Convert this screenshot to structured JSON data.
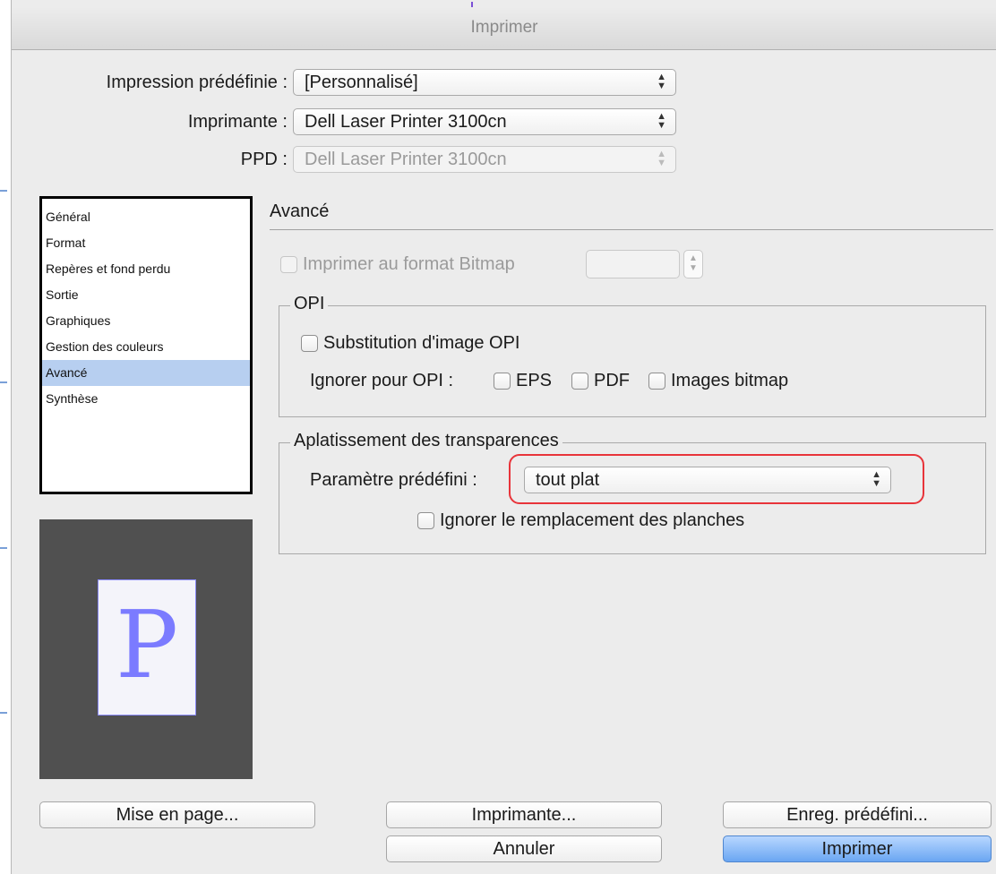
{
  "window": {
    "title": "Imprimer"
  },
  "header": {
    "preset": {
      "label": "Impression prédéfinie :",
      "value": "[Personnalisé]"
    },
    "printer": {
      "label": "Imprimante :",
      "value": "Dell Laser Printer 3100cn"
    },
    "ppd": {
      "label": "PPD :",
      "value": "Dell Laser Printer 3100cn"
    }
  },
  "sidebar": {
    "items": [
      {
        "label": "Général"
      },
      {
        "label": "Format"
      },
      {
        "label": "Repères et fond perdu"
      },
      {
        "label": "Sortie"
      },
      {
        "label": "Graphiques"
      },
      {
        "label": "Gestion des couleurs"
      },
      {
        "label": "Avancé",
        "selected": true
      },
      {
        "label": "Synthèse"
      }
    ]
  },
  "preview": {
    "letter": "P"
  },
  "advanced": {
    "title": "Avancé",
    "bitmap": {
      "label": "Imprimer au format Bitmap",
      "checked": false,
      "enabled": false,
      "value": ""
    },
    "opi": {
      "legend": "OPI",
      "substitution": {
        "label": "Substitution d'image OPI",
        "checked": false
      },
      "ignore_label": "Ignorer pour OPI :",
      "eps": {
        "label": "EPS",
        "checked": false
      },
      "pdf": {
        "label": "PDF",
        "checked": false
      },
      "bitmap_images": {
        "label": "Images bitmap",
        "checked": false
      }
    },
    "flattener": {
      "legend": "Aplatissement des transparences",
      "preset_label": "Paramètre prédéfini :",
      "preset_value": "tout plat",
      "ignore_spread": {
        "label": "Ignorer le remplacement des planches",
        "checked": false
      }
    }
  },
  "buttons": {
    "page_setup": "Mise en page...",
    "printer": "Imprimante...",
    "save_preset": "Enreg. prédéfini...",
    "cancel": "Annuler",
    "print": "Imprimer"
  },
  "colors": {
    "highlight": "#e8343a",
    "selection": "#b7cff0",
    "primary_button": "#6aa6f2",
    "preview_letter": "#7b7bff"
  }
}
